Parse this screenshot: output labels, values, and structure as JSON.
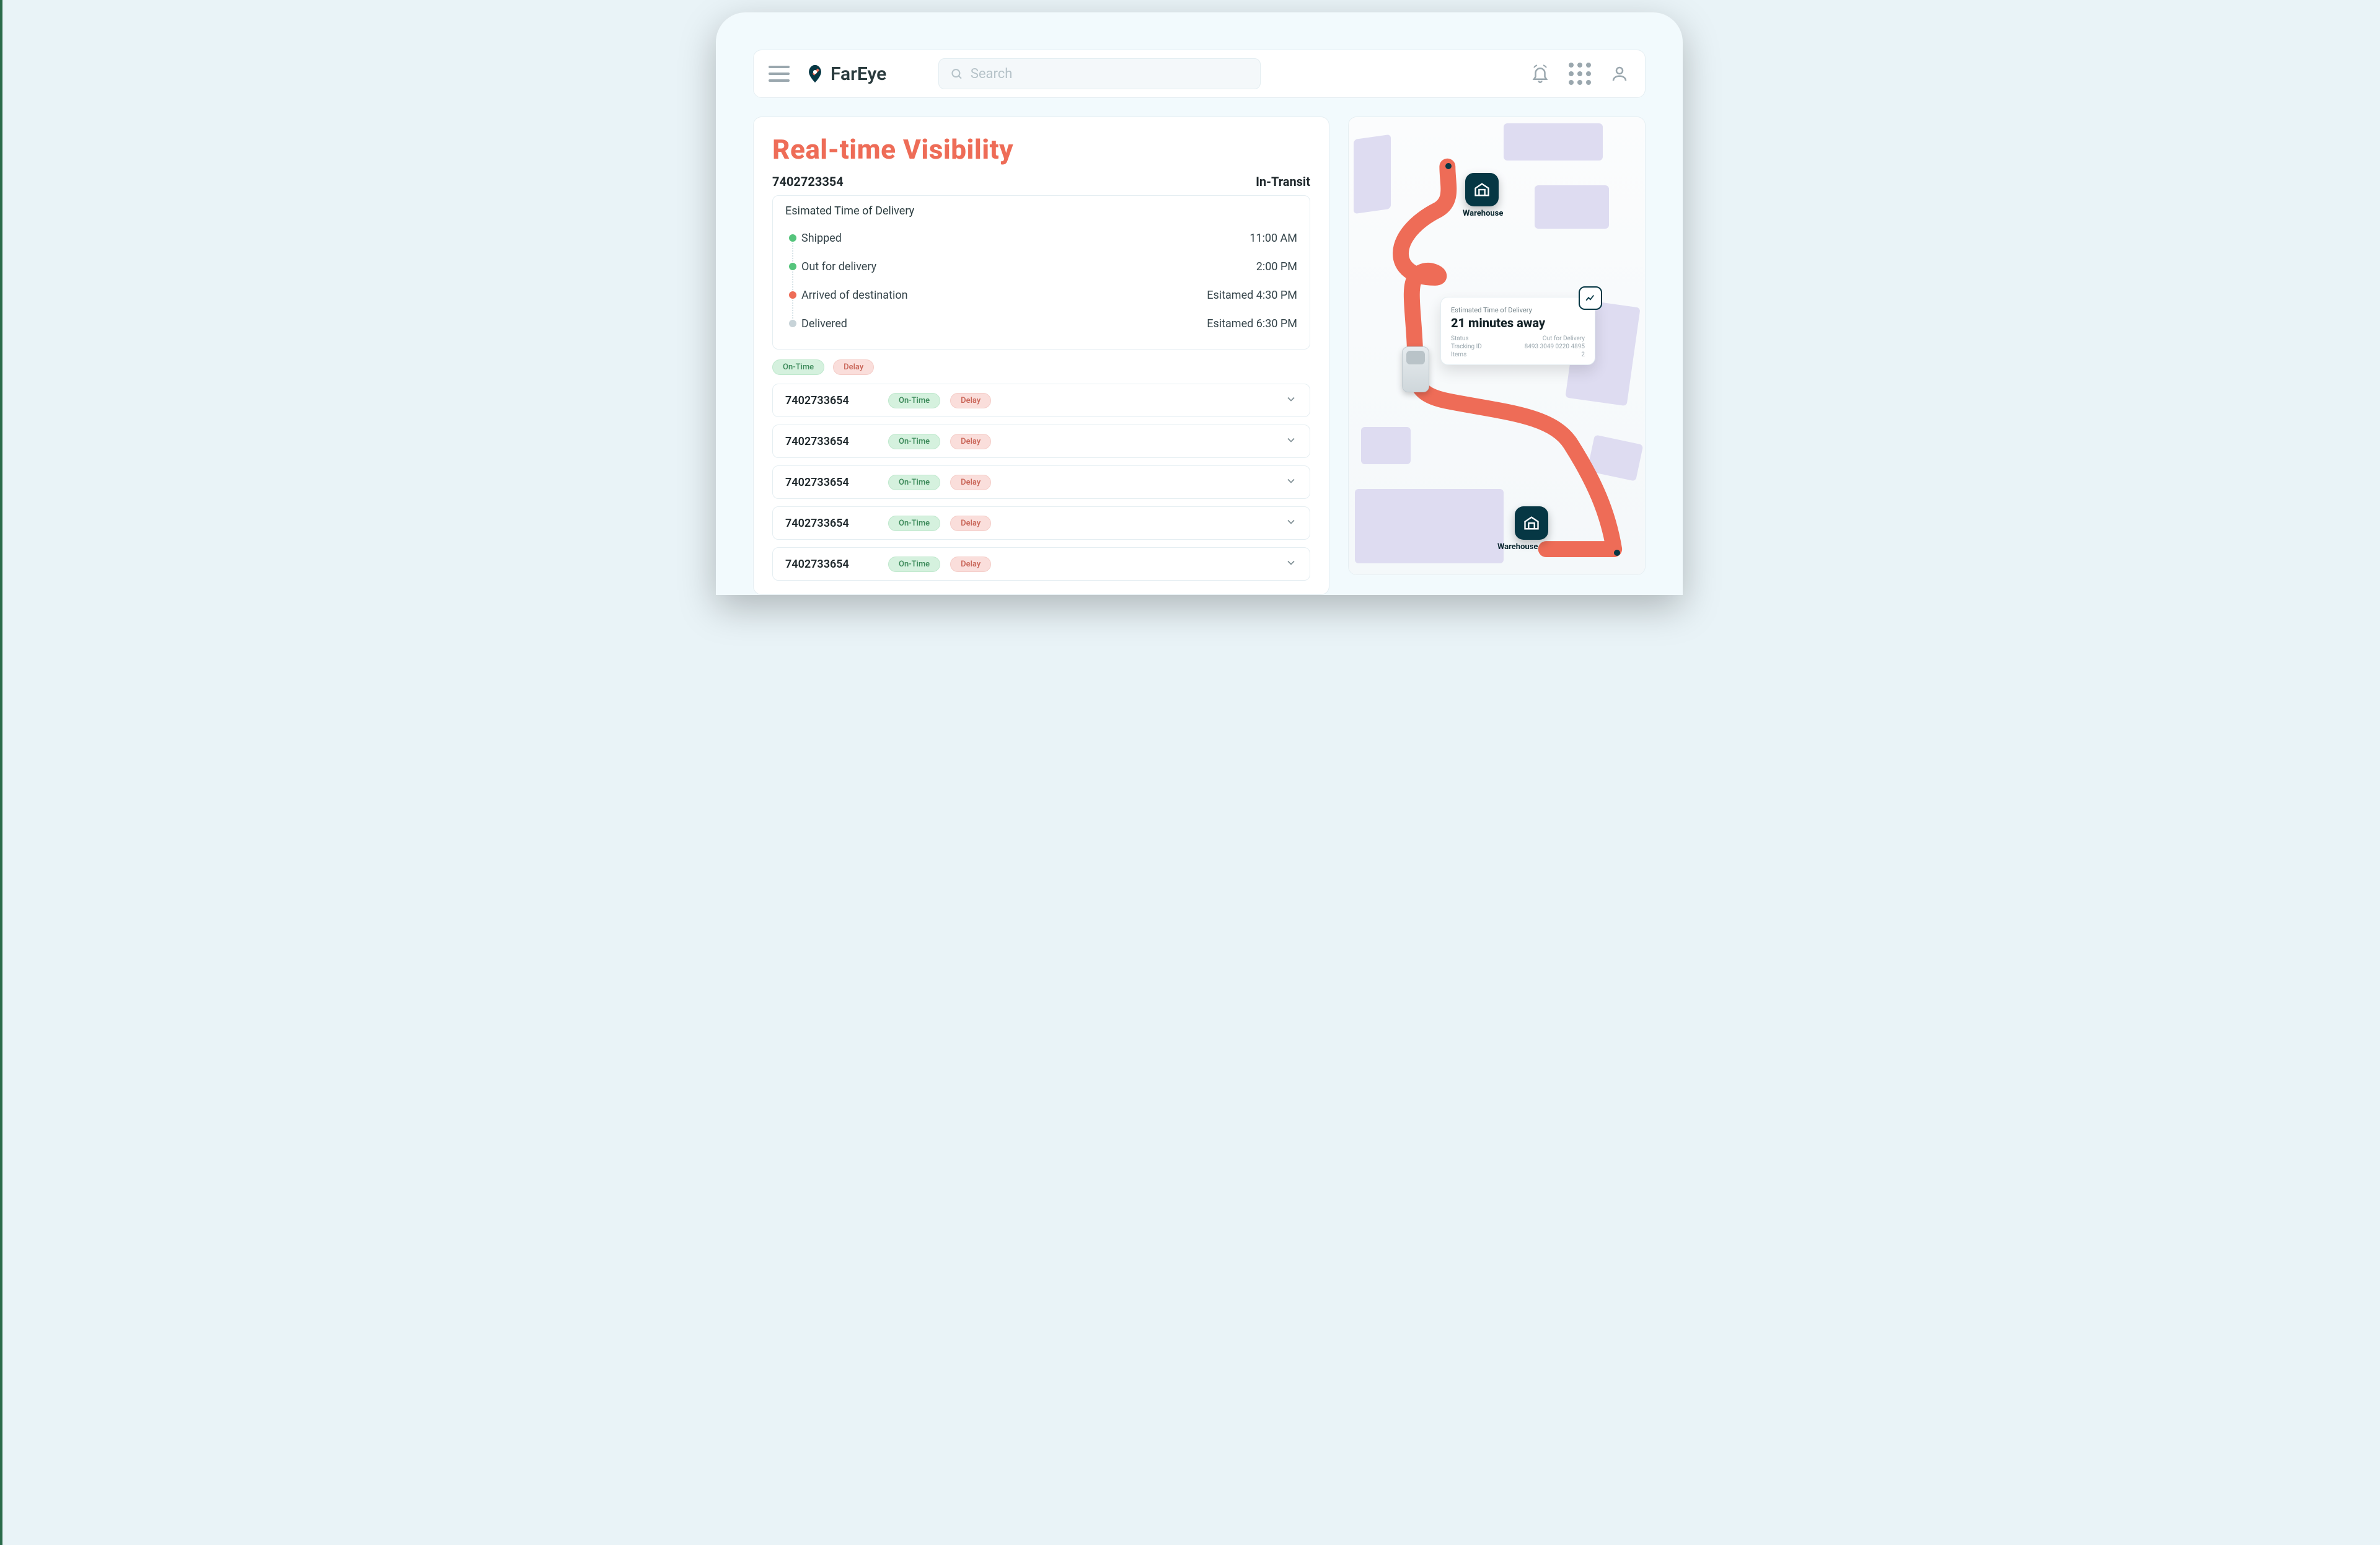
{
  "brand": "FarEye",
  "search": {
    "placeholder": "Search"
  },
  "header_icons": {
    "bell": "bell-icon",
    "grid": "apps-icon",
    "avatar": "avatar-icon"
  },
  "page": {
    "title": "Real-time Visibility",
    "current": {
      "tracking_id": "7402723354",
      "status": "In-Transit"
    },
    "eta_label": "Esimated Time of Delivery",
    "timeline": [
      {
        "label": "Shipped",
        "time": "11:00 AM",
        "dot": "green"
      },
      {
        "label": "Out for delivery",
        "time": "2:00 PM",
        "dot": "green"
      },
      {
        "label": "Arrived of destination",
        "time": "Esitamed 4:30 PM",
        "dot": "orange"
      },
      {
        "label": "Delivered",
        "time": "Esitamed 6:30 PM",
        "dot": "grey"
      }
    ],
    "filters": {
      "ontime": "On-Time",
      "delay": "Delay"
    },
    "shipments": [
      {
        "id": "7402733654",
        "ontime": "On-Time",
        "delay": "Delay"
      },
      {
        "id": "7402733654",
        "ontime": "On-Time",
        "delay": "Delay"
      },
      {
        "id": "7402733654",
        "ontime": "On-Time",
        "delay": "Delay"
      },
      {
        "id": "7402733654",
        "ontime": "On-Time",
        "delay": "Delay"
      },
      {
        "id": "7402733654",
        "ontime": "On-Time",
        "delay": "Delay"
      }
    ]
  },
  "map": {
    "origin_label": "Warehouse",
    "dest_label": "Warehouse",
    "popup": {
      "title": "Estimated Time of Delivery",
      "eta": "21 minutes away",
      "rows": [
        {
          "k": "Status",
          "v": "Out for Delivery"
        },
        {
          "k": "Tracking ID",
          "v": "8493 3049 0220 4895"
        },
        {
          "k": "Items",
          "v": "2"
        }
      ]
    }
  },
  "colors": {
    "accent": "#ee6c57",
    "brand_dark": "#063744",
    "green": "#55c47c"
  }
}
